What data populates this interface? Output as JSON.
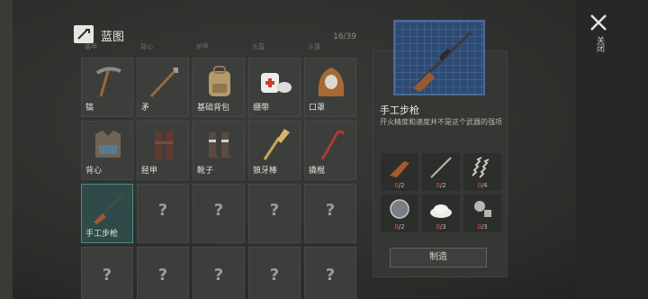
{
  "header": {
    "title": "蓝图",
    "count": "16/39"
  },
  "close": {
    "label": "关闭"
  },
  "top_partial_labels": [
    "装甲",
    "背心",
    "护甲",
    "头盔",
    "斗篷"
  ],
  "items": [
    {
      "label": "镐",
      "icon": "pickaxe-icon",
      "selected": false
    },
    {
      "label": "矛",
      "icon": "spear-icon",
      "selected": false
    },
    {
      "label": "基础背包",
      "icon": "backpack-icon",
      "selected": false
    },
    {
      "label": "绷带",
      "icon": "bandage-icon",
      "selected": false
    },
    {
      "label": "口罩",
      "icon": "hood-icon",
      "selected": false
    },
    {
      "label": "背心",
      "icon": "vest-icon",
      "selected": false
    },
    {
      "label": "胫甲",
      "icon": "greaves-icon",
      "selected": false
    },
    {
      "label": "靴子",
      "icon": "boots-icon",
      "selected": false
    },
    {
      "label": "狼牙棒",
      "icon": "mace-icon",
      "selected": false
    },
    {
      "label": "撬棍",
      "icon": "crowbar-icon",
      "selected": false
    },
    {
      "label": "手工步枪",
      "icon": "rifle-icon",
      "selected": true
    },
    {
      "label": "?",
      "icon": "unknown",
      "selected": false
    },
    {
      "label": "?",
      "icon": "unknown",
      "selected": false
    },
    {
      "label": "?",
      "icon": "unknown",
      "selected": false
    },
    {
      "label": "?",
      "icon": "unknown",
      "selected": false
    },
    {
      "label": "?",
      "icon": "unknown",
      "selected": false
    },
    {
      "label": "?",
      "icon": "unknown",
      "selected": false
    },
    {
      "label": "?",
      "icon": "unknown",
      "selected": false
    },
    {
      "label": "?",
      "icon": "unknown",
      "selected": false
    },
    {
      "label": "?",
      "icon": "unknown",
      "selected": false
    }
  ],
  "detail": {
    "title": "手工步枪",
    "description": "开火精度和速度并不是这个武器的强项",
    "materials": [
      {
        "icon": "gunstock-icon",
        "have": "0",
        "need": "/2"
      },
      {
        "icon": "metal-rod-icon",
        "have": "0",
        "need": "/2"
      },
      {
        "icon": "spring-icon",
        "have": "0",
        "need": "/4"
      },
      {
        "icon": "lens-icon",
        "have": "0",
        "need": "/2"
      },
      {
        "icon": "powder-icon",
        "have": "0",
        "need": "/3"
      },
      {
        "icon": "screw-icon",
        "have": "0",
        "need": "/3"
      }
    ],
    "craft_label": "制造"
  }
}
